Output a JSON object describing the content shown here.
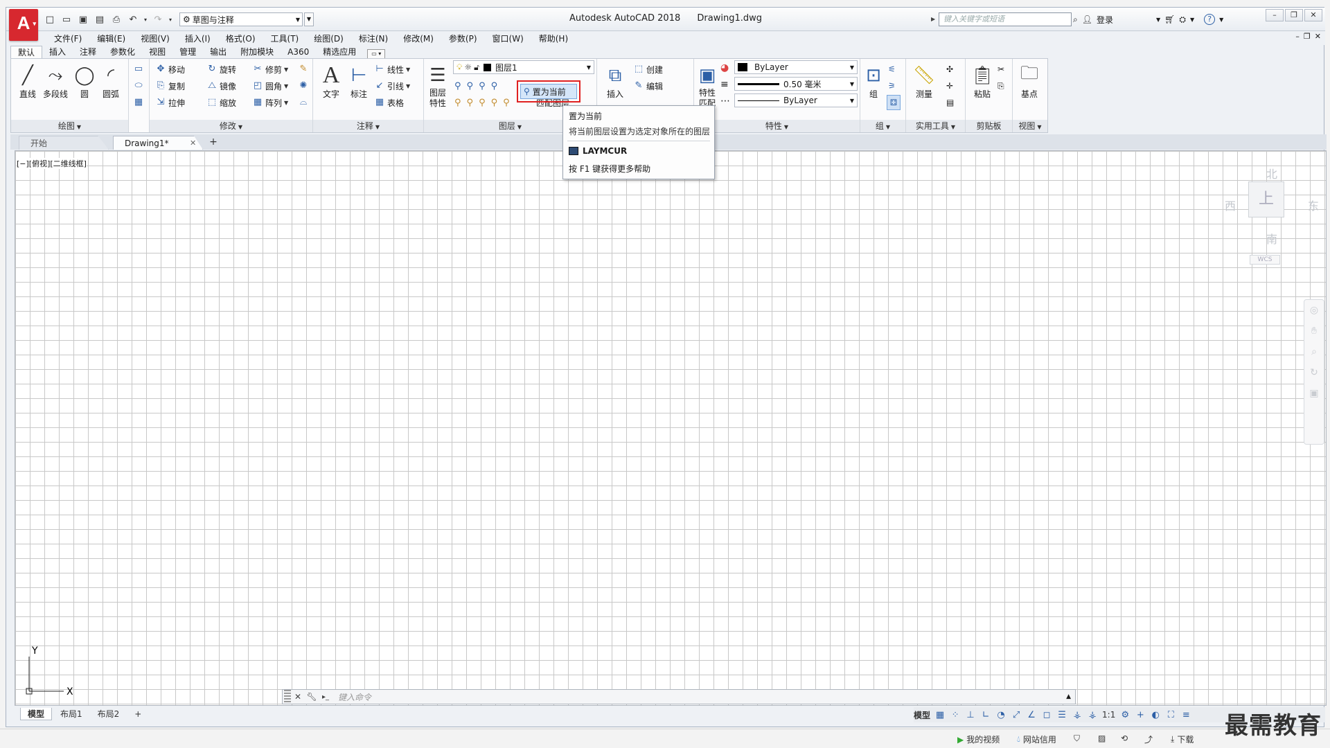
{
  "app": {
    "logo_letter": "A",
    "title": "Autodesk AutoCAD 2018",
    "file": "Drawing1.dwg",
    "workspace": "草图与注释",
    "search_placeholder": "键入关键字或短语",
    "login": "登录"
  },
  "menu": [
    "文件(F)",
    "编辑(E)",
    "视图(V)",
    "插入(I)",
    "格式(O)",
    "工具(T)",
    "绘图(D)",
    "标注(N)",
    "修改(M)",
    "参数(P)",
    "窗口(W)",
    "帮助(H)"
  ],
  "ribbon_tabs": [
    "默认",
    "插入",
    "注释",
    "参数化",
    "视图",
    "管理",
    "输出",
    "附加模块",
    "A360",
    "精选应用"
  ],
  "panels": {
    "draw": {
      "label": "绘图",
      "line": "直线",
      "polyline": "多段线",
      "circle": "圆",
      "arc": "圆弧"
    },
    "modify": {
      "label": "修改",
      "move": "移动",
      "rotate": "旋转",
      "trim": "修剪",
      "copy": "复制",
      "mirror": "镜像",
      "fillet": "圆角",
      "stretch": "拉伸",
      "scale": "缩放",
      "array": "阵列"
    },
    "annotation": {
      "label": "注释",
      "text": "文字",
      "dimension": "标注",
      "linear": "线性",
      "leader": "引线",
      "table": "表格"
    },
    "layers": {
      "label": "图层",
      "props": "图层特性",
      "layer_name": "图层1",
      "set_current": "置为当前",
      "match": "匹配图层"
    },
    "block": {
      "insert": "插入",
      "create": "创建",
      "edit": "编辑"
    },
    "properties": {
      "label": "特性",
      "match": "特性匹配",
      "color": "ByLayer",
      "lineweight": "0.50 毫米",
      "linetype": "ByLayer"
    },
    "groups": {
      "label": "组",
      "group": "组"
    },
    "utilities": {
      "label": "实用工具",
      "measure": "测量"
    },
    "clipboard": {
      "label": "剪贴板",
      "paste": "粘贴"
    },
    "view": {
      "label": "视图",
      "base": "基点"
    }
  },
  "tooltip": {
    "title": "置为当前",
    "desc": "将当前图层设置为选定对象所在的图层",
    "command": "LAYMCUR",
    "help": "按 F1 键获得更多帮助"
  },
  "doc_tabs": {
    "start": "开始",
    "current": "Drawing1*"
  },
  "viewport_label": "[−][俯视][二维线框]",
  "viewcube": {
    "n": "北",
    "s": "南",
    "e": "东",
    "w": "西",
    "top": "上",
    "wcs": "WCS"
  },
  "ucs": {
    "x": "X",
    "y": "Y"
  },
  "command_placeholder": "键入命令",
  "layout_tabs": [
    "模型",
    "布局1",
    "布局2"
  ],
  "status": {
    "model": "模型",
    "scale": "1:1"
  },
  "host_bar": {
    "video": "我的视频",
    "credit": "网站信用",
    "download": "下载"
  },
  "watermark": "最需教育"
}
